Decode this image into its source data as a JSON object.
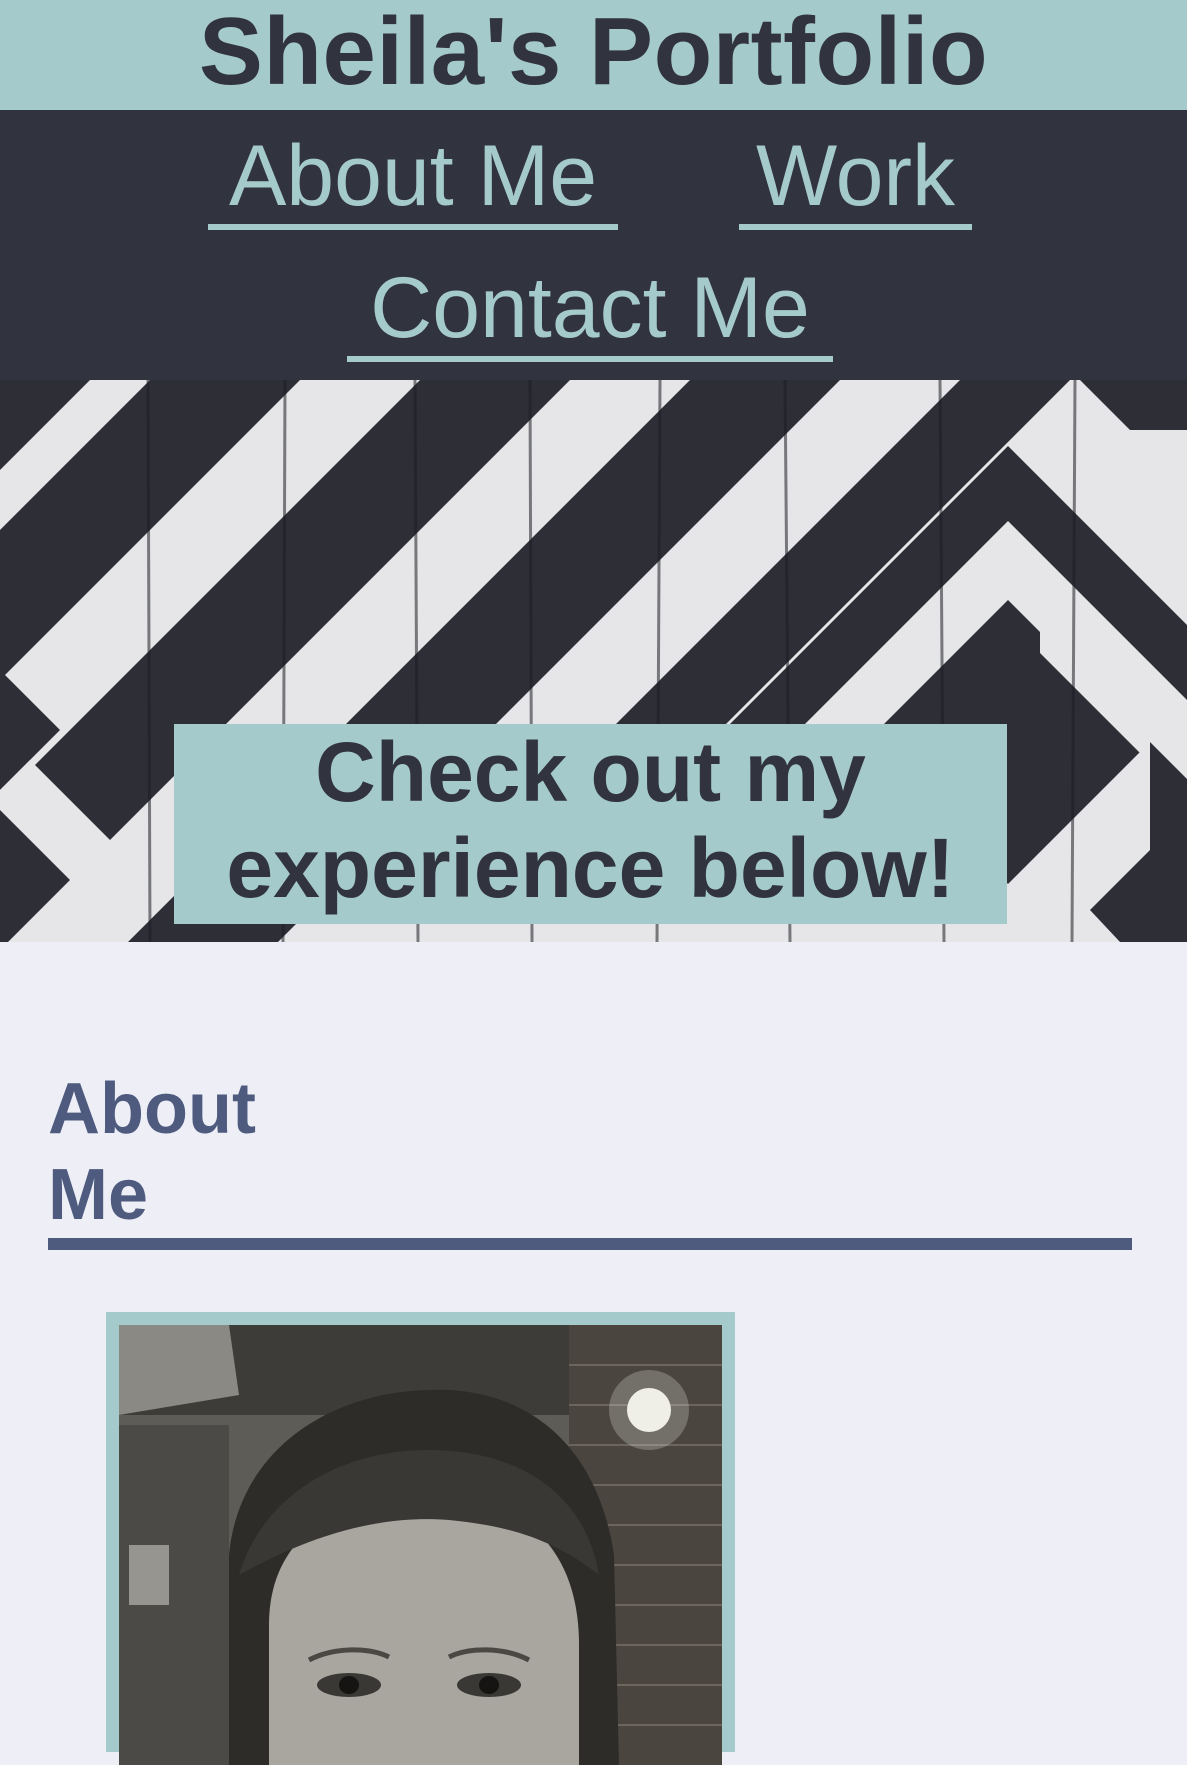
{
  "header": {
    "title": "Sheila's Portfolio"
  },
  "nav": {
    "items": [
      {
        "label": "About Me"
      },
      {
        "label": "Work"
      },
      {
        "label": "Contact Me"
      }
    ]
  },
  "hero": {
    "banner_line1": "Check out my",
    "banner_line2": "experience below!"
  },
  "about": {
    "heading_line1": "About",
    "heading_line2": "Me"
  },
  "colors": {
    "accent": "#a5cacc",
    "dark": "#31333f",
    "page_background": "#edeef6",
    "heading": "#4e5a7e"
  }
}
